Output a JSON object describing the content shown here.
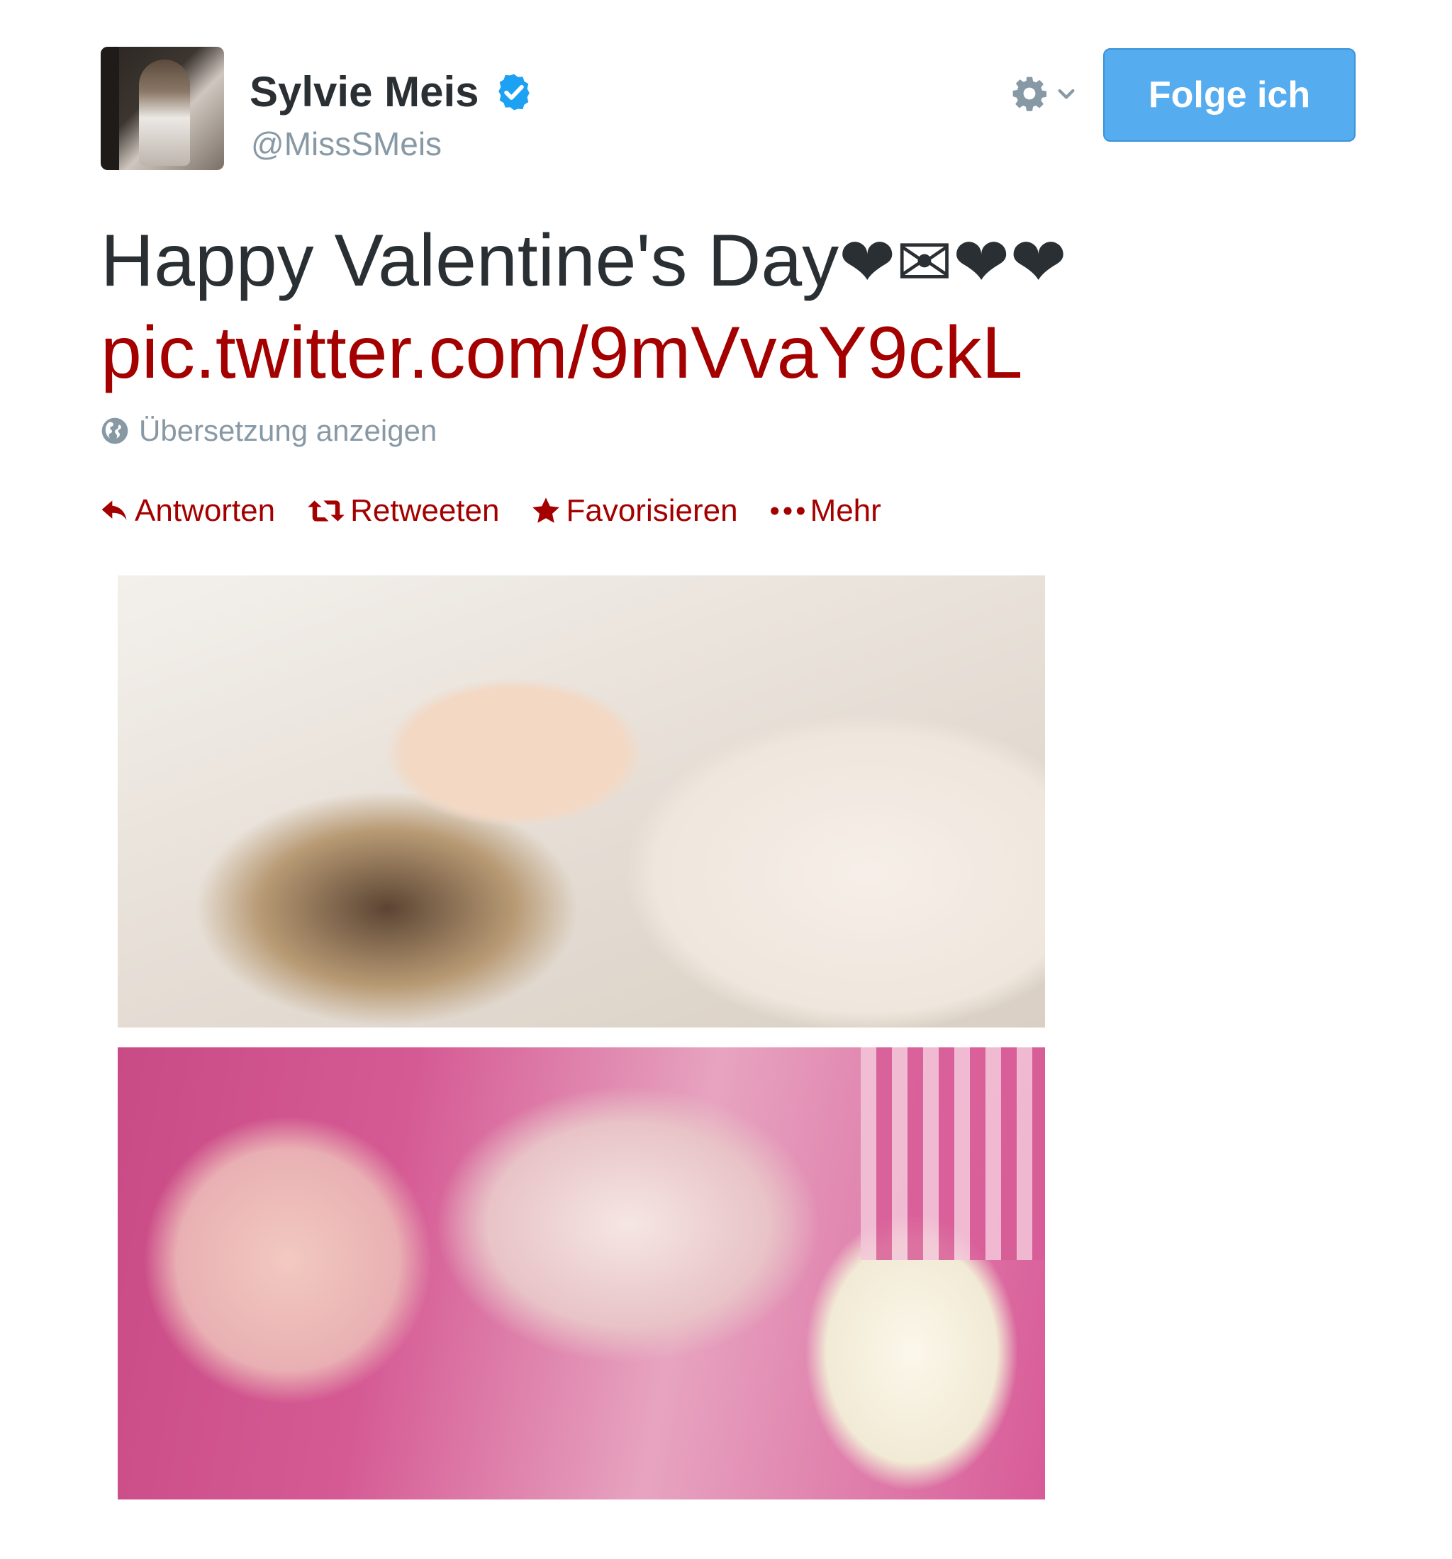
{
  "user": {
    "display_name": "Sylvie Meis",
    "handle": "@MissSMeis",
    "verified": true
  },
  "header": {
    "follow_button_label": "Folge ich"
  },
  "tweet": {
    "text": "Happy Valentine's Day",
    "emoji": "❤✉❤❤",
    "link": "pic.twitter.com/9mVvaY9ckL",
    "translate_label": "Übersetzung anzeigen"
  },
  "actions": [
    {
      "label": "Antworten",
      "icon": "reply-icon"
    },
    {
      "label": "Retweeten",
      "icon": "retweet-icon"
    },
    {
      "label": "Favorisieren",
      "icon": "star-icon"
    },
    {
      "label": "Mehr",
      "icon": "more-dots-icon"
    }
  ],
  "media": [
    {
      "name": "photo-1"
    },
    {
      "name": "photo-2"
    }
  ],
  "colors": {
    "link": "#a40000",
    "follow_button": "#55acee",
    "verified": "#1da1f2",
    "text": "#292f33",
    "muted": "#8899a6"
  }
}
